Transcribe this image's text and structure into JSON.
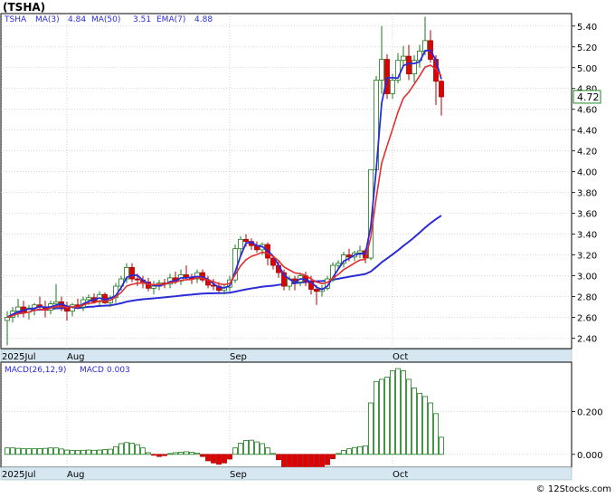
{
  "chart_data": [
    {
      "type": "candlestick",
      "title": "(TSHA)",
      "legend": {
        "symbol": "TSHA",
        "items": [
          {
            "label": "MA(3)",
            "value": "4.84",
            "color": "#2b2bd8"
          },
          {
            "label": "MA(50)",
            "value": "3.51",
            "color": "#2b2bd8"
          },
          {
            "label": "EMA(7)",
            "value": "4.88",
            "color": "#2b2bd8"
          }
        ]
      },
      "ylim": [
        2.3,
        5.52
      ],
      "y_ticks": [
        "5.40",
        "5.20",
        "5.00",
        "4.80",
        "4.60",
        "4.40",
        "4.20",
        "4.00",
        "3.80",
        "3.60",
        "3.40",
        "3.20",
        "3.00",
        "2.80",
        "2.60",
        "2.40"
      ],
      "x_labels": [
        {
          "label": "2025Jul",
          "index": 0
        },
        {
          "label": "Aug",
          "index": 11
        },
        {
          "label": "Sep",
          "index": 41
        },
        {
          "label": "Oct",
          "index": 71
        }
      ],
      "last_price": "4.72",
      "candles": [
        [
          2.57,
          2.66,
          2.33,
          2.6
        ],
        [
          2.6,
          2.7,
          2.55,
          2.66
        ],
        [
          2.66,
          2.78,
          2.6,
          2.7
        ],
        [
          2.7,
          2.76,
          2.6,
          2.65
        ],
        [
          2.65,
          2.72,
          2.58,
          2.69
        ],
        [
          2.69,
          2.74,
          2.62,
          2.72
        ],
        [
          2.72,
          2.8,
          2.67,
          2.7
        ],
        [
          2.7,
          2.76,
          2.6,
          2.67
        ],
        [
          2.67,
          2.76,
          2.63,
          2.73
        ],
        [
          2.73,
          2.92,
          2.68,
          2.75
        ],
        [
          2.75,
          2.8,
          2.66,
          2.71
        ],
        [
          2.71,
          2.75,
          2.57,
          2.66
        ],
        [
          2.66,
          2.74,
          2.61,
          2.72
        ],
        [
          2.72,
          2.78,
          2.68,
          2.7
        ],
        [
          2.7,
          2.8,
          2.66,
          2.77
        ],
        [
          2.77,
          2.82,
          2.72,
          2.79
        ],
        [
          2.79,
          2.83,
          2.74,
          2.75
        ],
        [
          2.75,
          2.85,
          2.71,
          2.82
        ],
        [
          2.82,
          2.84,
          2.73,
          2.74
        ],
        [
          2.74,
          2.81,
          2.7,
          2.79
        ],
        [
          2.79,
          2.93,
          2.74,
          2.9
        ],
        [
          2.9,
          3.0,
          2.86,
          2.97
        ],
        [
          2.97,
          3.12,
          2.93,
          3.08
        ],
        [
          3.08,
          3.12,
          2.94,
          2.97
        ],
        [
          2.97,
          3.02,
          2.9,
          2.96
        ],
        [
          2.96,
          3.0,
          2.88,
          2.94
        ],
        [
          2.94,
          2.98,
          2.85,
          2.88
        ],
        [
          2.88,
          2.95,
          2.82,
          2.9
        ],
        [
          2.9,
          2.96,
          2.86,
          2.93
        ],
        [
          2.93,
          2.97,
          2.88,
          2.92
        ],
        [
          2.92,
          3.02,
          2.88,
          2.98
        ],
        [
          2.98,
          3.04,
          2.92,
          2.95
        ],
        [
          2.95,
          3.06,
          2.91,
          3.01
        ],
        [
          3.01,
          3.1,
          2.96,
          2.98
        ],
        [
          2.98,
          3.02,
          2.92,
          2.97
        ],
        [
          2.97,
          3.06,
          2.93,
          3.03
        ],
        [
          3.03,
          3.06,
          2.94,
          2.96
        ],
        [
          2.96,
          3.0,
          2.88,
          2.91
        ],
        [
          2.91,
          2.97,
          2.86,
          2.9
        ],
        [
          2.9,
          2.94,
          2.84,
          2.86
        ],
        [
          2.86,
          2.92,
          2.82,
          2.89
        ],
        [
          2.89,
          3.0,
          2.85,
          2.96
        ],
        [
          2.96,
          3.3,
          2.93,
          3.26
        ],
        [
          3.26,
          3.38,
          3.2,
          3.35
        ],
        [
          3.35,
          3.4,
          3.28,
          3.33
        ],
        [
          3.33,
          3.36,
          3.25,
          3.29
        ],
        [
          3.29,
          3.33,
          3.22,
          3.25
        ],
        [
          3.25,
          3.32,
          3.2,
          3.3
        ],
        [
          3.3,
          3.32,
          3.1,
          3.17
        ],
        [
          3.17,
          3.19,
          3.06,
          3.1
        ],
        [
          3.1,
          3.14,
          2.98,
          3.03
        ],
        [
          3.03,
          3.06,
          2.86,
          2.9
        ],
        [
          2.9,
          3.0,
          2.86,
          2.97
        ],
        [
          2.97,
          3.0,
          2.86,
          2.94
        ],
        [
          2.94,
          3.03,
          2.9,
          3.0
        ],
        [
          3.0,
          3.04,
          2.9,
          2.95
        ],
        [
          2.95,
          3.0,
          2.82,
          2.87
        ],
        [
          2.87,
          2.91,
          2.72,
          2.85
        ],
        [
          2.85,
          2.91,
          2.8,
          2.88
        ],
        [
          2.88,
          3.0,
          2.86,
          2.97
        ],
        [
          2.97,
          3.13,
          2.94,
          3.1
        ],
        [
          3.1,
          3.15,
          3.06,
          3.12
        ],
        [
          3.12,
          3.23,
          3.08,
          3.2
        ],
        [
          3.2,
          3.26,
          3.14,
          3.18
        ],
        [
          3.18,
          3.24,
          3.14,
          3.22
        ],
        [
          3.22,
          3.29,
          3.17,
          3.24
        ],
        [
          3.24,
          3.26,
          3.12,
          3.17
        ],
        [
          3.17,
          3.4,
          3.15,
          4.02
        ],
        [
          4.02,
          4.92,
          3.99,
          4.88
        ],
        [
          4.88,
          5.4,
          4.75,
          5.08
        ],
        [
          5.08,
          5.13,
          4.7,
          4.75
        ],
        [
          4.75,
          4.94,
          4.7,
          4.88
        ],
        [
          4.88,
          5.14,
          4.85,
          5.07
        ],
        [
          5.07,
          5.21,
          5.02,
          5.11
        ],
        [
          5.11,
          5.22,
          4.88,
          4.94
        ],
        [
          4.94,
          5.12,
          4.86,
          5.07
        ],
        [
          5.07,
          5.22,
          5.0,
          5.16
        ],
        [
          5.16,
          5.49,
          5.12,
          5.26
        ],
        [
          5.26,
          5.36,
          5.05,
          5.08
        ],
        [
          5.08,
          5.12,
          4.64,
          4.87
        ],
        [
          4.87,
          4.88,
          4.54,
          4.72
        ]
      ]
    },
    {
      "type": "bar",
      "title": "MACD(26,12,9)",
      "legend": {
        "label": "MACD",
        "value": "0.003",
        "color": "#2b2bd8"
      },
      "ylim": [
        -0.06,
        0.43
      ],
      "y_ticks": [
        "0.200",
        "0.000"
      ],
      "x_labels": [
        {
          "label": "2025Jul",
          "index": 0
        },
        {
          "label": "Aug",
          "index": 11
        },
        {
          "label": "Sep",
          "index": 41
        },
        {
          "label": "Oct",
          "index": 71
        }
      ],
      "values": [
        0.03,
        0.03,
        0.028,
        0.026,
        0.026,
        0.026,
        0.027,
        0.028,
        0.03,
        0.03,
        0.025,
        0.02,
        0.018,
        0.018,
        0.019,
        0.02,
        0.019,
        0.02,
        0.022,
        0.024,
        0.036,
        0.05,
        0.055,
        0.052,
        0.045,
        0.03,
        0.008,
        -0.004,
        -0.01,
        -0.006,
        0.004,
        0.008,
        0.01,
        0.012,
        0.01,
        0.006,
        -0.01,
        -0.03,
        -0.04,
        -0.046,
        -0.04,
        -0.022,
        0.03,
        0.052,
        0.065,
        0.066,
        0.058,
        0.05,
        0.03,
        0.004,
        -0.025,
        -0.058,
        -0.075,
        -0.085,
        -0.09,
        -0.092,
        -0.095,
        -0.092,
        -0.075,
        -0.048,
        -0.02,
        0.004,
        0.018,
        0.026,
        0.032,
        0.036,
        0.04,
        0.24,
        0.34,
        0.35,
        0.36,
        0.39,
        0.4,
        0.39,
        0.35,
        0.31,
        0.285,
        0.27,
        0.24,
        0.19,
        0.08
      ]
    }
  ],
  "footer": {
    "copyright": "© 12Stocks.com"
  }
}
